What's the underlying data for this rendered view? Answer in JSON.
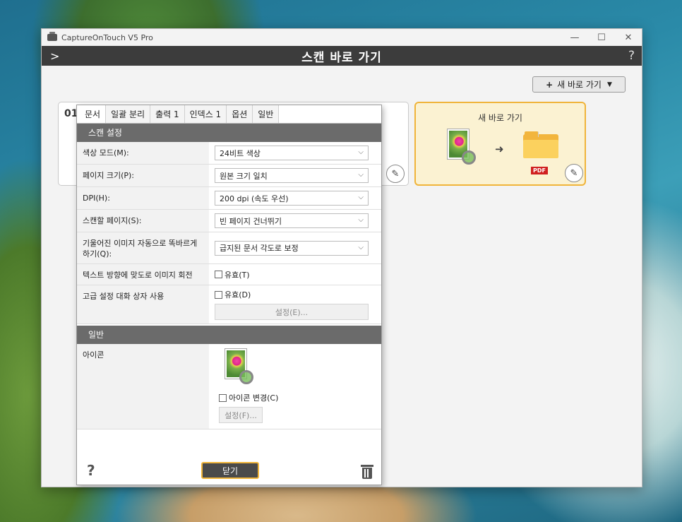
{
  "window": {
    "app_title": "CaptureOnTouch V5 Pro",
    "controls": {
      "minimize": "—",
      "maximize": "☐",
      "close": "✕"
    }
  },
  "header": {
    "title": "스캔 바로 가기",
    "expand_glyph": ">",
    "help_glyph": "?"
  },
  "new_shortcut_button": {
    "label": "새 바로 가기",
    "plus": "+",
    "caret": "▼"
  },
  "shortcuts": [
    {
      "number": "01"
    },
    {
      "label": "새 바로 가기",
      "output_badge": "PDF",
      "selected": true
    }
  ],
  "panel": {
    "tabs": [
      "문서",
      "일괄 분리",
      "출력 1",
      "인덱스 1",
      "옵션",
      "일반"
    ],
    "active_tab": "문서",
    "scan_section": {
      "title": "스캔 설정",
      "rows": [
        {
          "label": "색상 모드(M):",
          "value": "24비트 색상"
        },
        {
          "label": "페이지 크기(P):",
          "value": "원본 크기 일치"
        },
        {
          "label": "DPI(H):",
          "value": "200 dpi (속도 우선)"
        },
        {
          "label": "스캔할 페이지(S):",
          "value": "빈 페이지 건너뛰기"
        },
        {
          "label": "기울어진 이미지 자동으로 똑바르게 하기(Q):",
          "value": "급지된 문서 각도로 보정"
        }
      ],
      "rotate_row": {
        "label": "텍스트 방향에 맞도로 이미지 회전",
        "checkbox": "유효(T)",
        "checked": false
      },
      "advanced_row": {
        "label": "고급 설정 대화 상자 사용",
        "checkbox": "유효(D)",
        "checked": false,
        "settings_button": "설정(E)..."
      }
    },
    "general_section": {
      "title": "일반",
      "icon_row": {
        "label": "아이콘",
        "checkbox": "아이콘 변경(C)",
        "checked": false,
        "settings_button": "설정(F)..."
      }
    },
    "footer": {
      "help": "?",
      "close_button": "닫기"
    }
  }
}
